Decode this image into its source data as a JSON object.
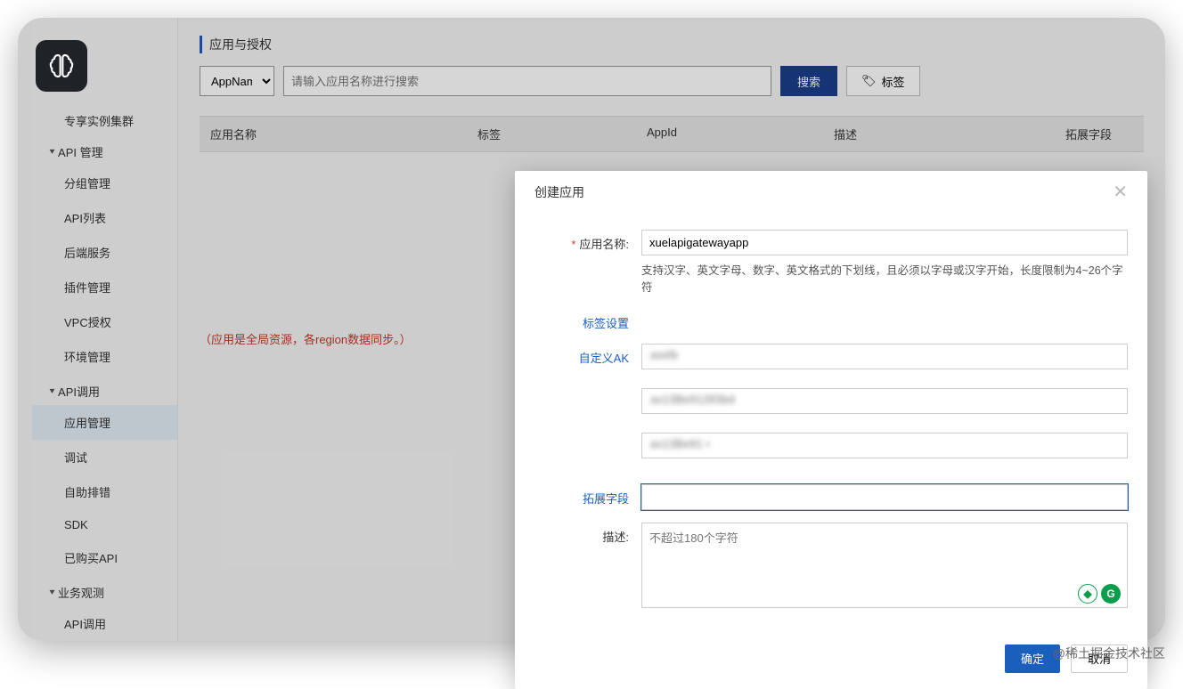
{
  "page_title": "应用与授权",
  "brain_icon": "🧠",
  "watermark": "@稀土掘金技术社区",
  "sidebar": {
    "top_item": "专享实例集群",
    "groups": [
      {
        "head": "API 管理",
        "items": [
          "分组管理",
          "API列表",
          "后端服务",
          "插件管理",
          "VPC授权",
          "环境管理"
        ]
      },
      {
        "head": "API调用",
        "items": [
          "应用管理",
          "调试",
          "自助排错",
          "SDK",
          "已购买API"
        ],
        "active_index": 0
      },
      {
        "head": "业务观测",
        "items": [
          "API调用"
        ]
      }
    ]
  },
  "toolbar": {
    "select_value": "AppName",
    "search_placeholder": "请输入应用名称进行搜索",
    "search_btn": "搜索",
    "tag_btn": "标签",
    "tag_icon": "🏷"
  },
  "table": {
    "cols": [
      "应用名称",
      "标签",
      "AppId",
      "描述",
      "拓展字段"
    ]
  },
  "note": "（应用是全局资源，各region数据同步。）",
  "modal": {
    "title": "创建应用",
    "name_label": "应用名称:",
    "name_value": "xuelapigatewayapp",
    "name_hint": "支持汉字、英文字母、数字、英文格式的下划线，且必须以字母或汉字开始，长度限制为4~26个字符",
    "tag_label": "标签设置",
    "ak_label": "自定义AK",
    "ak_blur1": "axelb",
    "ak_blur2": "ax13Be91283bd",
    "ak_blur3": "ax13Be91 •",
    "ext_label": "拓展字段",
    "desc_label": "描述:",
    "desc_placeholder": "不超过180个字符",
    "ok": "确定",
    "cancel": "取消"
  }
}
